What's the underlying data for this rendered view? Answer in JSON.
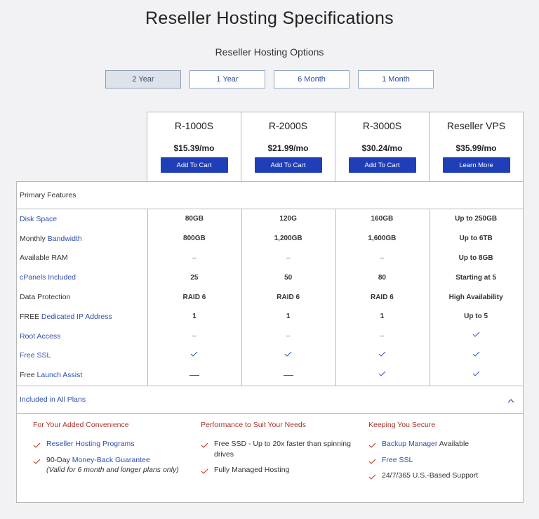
{
  "page": {
    "title": "Reseller Hosting Specifications",
    "subtitle": "Reseller Hosting Options"
  },
  "terms": [
    {
      "label": "2 Year",
      "active": true
    },
    {
      "label": "1 Year",
      "active": false
    },
    {
      "label": "6 Month",
      "active": false
    },
    {
      "label": "1 Month",
      "active": false
    }
  ],
  "plans": [
    {
      "name": "R-1000S",
      "price": "$15.39/mo",
      "button": "Add To Cart"
    },
    {
      "name": "R-2000S",
      "price": "$21.99/mo",
      "button": "Add To Cart"
    },
    {
      "name": "R-3000S",
      "price": "$30.24/mo",
      "button": "Add To Cart"
    },
    {
      "name": "Reseller VPS",
      "price": "$35.99/mo",
      "button": "Learn More"
    }
  ],
  "features": {
    "section_label": "Primary Features",
    "rows": [
      {
        "label_pre": "",
        "label_link": "Disk Space",
        "values": [
          "80GB",
          "120G",
          "160GB",
          "Up to 250GB"
        ]
      },
      {
        "label_pre": "Monthly ",
        "label_link": "Bandwidth",
        "values": [
          "800GB",
          "1,200GB",
          "1,600GB",
          "Up to 6TB"
        ]
      },
      {
        "label_pre": "Available RAM",
        "label_link": "",
        "values": [
          "–",
          "–",
          "–",
          "Up to 8GB"
        ]
      },
      {
        "label_pre": "",
        "label_link": "cPanels Included",
        "values": [
          "25",
          "50",
          "80",
          "Starting at 5"
        ]
      },
      {
        "label_pre": "Data Protection",
        "label_link": "",
        "values": [
          "RAID 6",
          "RAID 6",
          "RAID 6",
          "High Availability"
        ]
      },
      {
        "label_pre": "FREE ",
        "label_link": "Dedicated IP Address",
        "values": [
          "1",
          "1",
          "1",
          "Up to 5"
        ]
      },
      {
        "label_pre": "",
        "label_link": "Root Access",
        "values": [
          "–",
          "–",
          "–",
          "check"
        ]
      },
      {
        "label_pre": "",
        "label_link": "Free SSL",
        "values": [
          "check",
          "check",
          "check",
          "check"
        ]
      },
      {
        "label_pre": "Free ",
        "label_link": "Launch Assist",
        "values": [
          "longdash",
          "longdash",
          "check",
          "check"
        ]
      }
    ]
  },
  "included": {
    "title": "Included in All Plans",
    "columns": [
      {
        "heading": "For Your Added Convenience",
        "items": [
          {
            "pre": "",
            "link": "Reseller Hosting Programs",
            "post": "",
            "note": ""
          },
          {
            "pre": "90-Day ",
            "link": "Money-Back Guarantee",
            "post": "",
            "note": "(Valid for 6 month and longer plans only)"
          }
        ]
      },
      {
        "heading": "Performance to Suit Your Needs",
        "items": [
          {
            "pre": "Free SSD - Up to 20x faster than spinning drives",
            "link": "",
            "post": "",
            "note": ""
          },
          {
            "pre": "Fully Managed Hosting",
            "link": "",
            "post": "",
            "note": ""
          }
        ]
      },
      {
        "heading": "Keeping You Secure",
        "items": [
          {
            "pre": "",
            "link": "Backup Manager",
            "post": " Available",
            "note": ""
          },
          {
            "pre": "",
            "link": "Free SSL",
            "post": "",
            "note": ""
          },
          {
            "pre": "24/7/365 U.S.-Based Support",
            "link": "",
            "post": "",
            "note": ""
          }
        ]
      }
    ]
  },
  "colors": {
    "accent": "#1f3fb9",
    "link": "#2f4fb0",
    "heading_red": "#a8342c",
    "check_blue": "#3a5bc7",
    "check_red": "#c0392b"
  }
}
